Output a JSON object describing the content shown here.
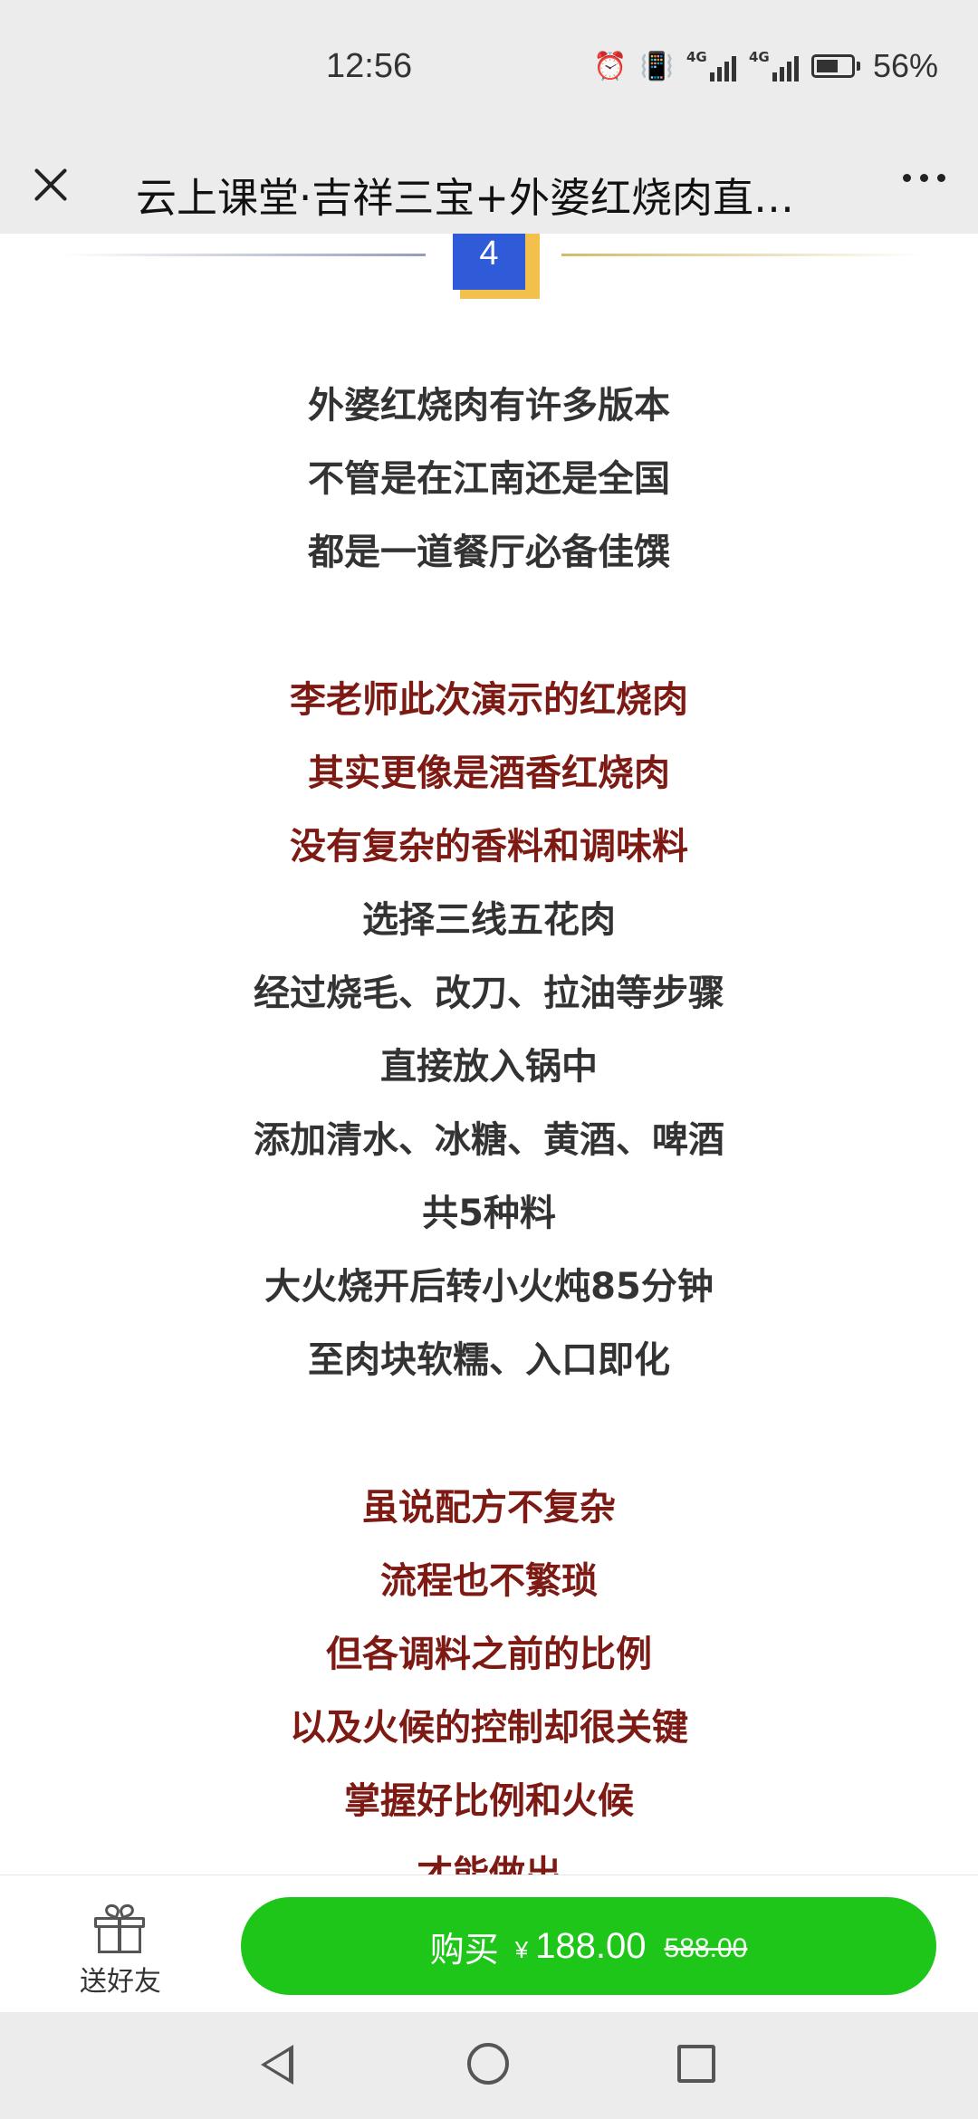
{
  "status_bar": {
    "time": "12:56",
    "signal1_tag": "4G",
    "signal2_tag": "4G",
    "battery_percent": "56%",
    "icons": [
      "alarm-icon",
      "vibrate-icon",
      "signal-icon",
      "signal-icon",
      "battery-icon"
    ]
  },
  "title_bar": {
    "title": "云上课堂·吉祥三宝+外婆红烧肉直…",
    "close_icon": "close-icon",
    "more_icon": "more-icon"
  },
  "section": {
    "number": "4"
  },
  "article_lines": [
    {
      "text": "外婆红烧肉有许多版本",
      "color": "dark"
    },
    {
      "text": "不管是在江南还是全国",
      "color": "dark"
    },
    {
      "text": "都是一道餐厅必备佳馔",
      "color": "dark"
    },
    {
      "text": "",
      "color": "gap"
    },
    {
      "text": "李老师此次演示的红烧肉",
      "color": "red"
    },
    {
      "text": "其实更像是酒香红烧肉",
      "color": "red"
    },
    {
      "text": "没有复杂的香料和调味料",
      "color": "red"
    },
    {
      "text": "选择三线五花肉",
      "color": "dark"
    },
    {
      "text": "经过烧毛、改刀、拉油等步骤",
      "color": "dark"
    },
    {
      "text": "直接放入锅中",
      "color": "dark"
    },
    {
      "text": "添加清水、冰糖、黄酒、啤酒",
      "color": "dark"
    },
    {
      "text": "共5种料",
      "color": "dark"
    },
    {
      "text": "大火烧开后转小火炖85分钟",
      "color": "dark"
    },
    {
      "text": "至肉块软糯、入口即化",
      "color": "dark"
    },
    {
      "text": "",
      "color": "gap"
    },
    {
      "text": "虽说配方不复杂",
      "color": "red"
    },
    {
      "text": "流程也不繁琐",
      "color": "red"
    },
    {
      "text": "但各调料之前的比例",
      "color": "red"
    },
    {
      "text": "以及火候的控制却很关键",
      "color": "red"
    },
    {
      "text": "掌握好比例和火候",
      "color": "red"
    },
    {
      "text": "才能做出",
      "color": "red"
    }
  ],
  "colors": {
    "dark_text": "#333333",
    "red_text": "#7d1a14",
    "buy_button": "#1ec61a",
    "badge": "#2f5bd9",
    "badge_shadow": "#f2c04b"
  },
  "buy_bar": {
    "gift_label": "送好友",
    "gift_icon": "gift-icon",
    "buy_label": "购买",
    "currency": "¥",
    "price": "188.00",
    "original_price": "588.00"
  },
  "nav_bar": {
    "icons": [
      "back-icon",
      "home-icon",
      "recents-icon"
    ]
  }
}
